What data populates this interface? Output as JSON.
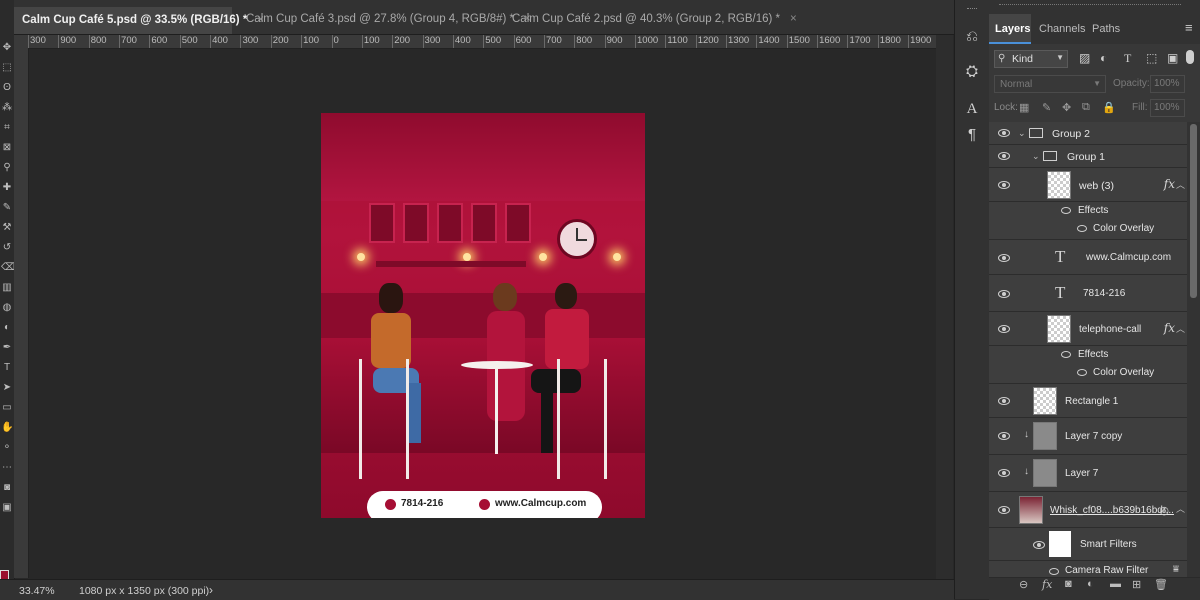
{
  "tabs": [
    {
      "label": "Calm Cup Café 5.psd @ 33.5% (RGB/16) *",
      "active": true
    },
    {
      "label": "Calm Cup Café 3.psd @ 27.8% (Group 4, RGB/8#) *",
      "active": false
    },
    {
      "label": "Calm Cup Café 2.psd @ 40.3% (Group 2, RGB/16) *",
      "active": false
    }
  ],
  "tab_close": "×",
  "ruler": [
    "300",
    "900",
    "800",
    "700",
    "600",
    "500",
    "400",
    "300",
    "200",
    "100",
    "0",
    "100",
    "200",
    "300",
    "400",
    "500",
    "600",
    "700",
    "800",
    "900",
    "1000",
    "1100",
    "1200",
    "1300",
    "1400",
    "1500",
    "1600",
    "1700",
    "1800",
    "1900",
    "200"
  ],
  "status": {
    "zoom": "33.47%",
    "doc_size": "1080 px x 1350 px (300 ppi)",
    "arrow": "›"
  },
  "artwork": {
    "phone": "7814-216",
    "web": "www.Calmcup.com"
  },
  "panel": {
    "tabs": [
      "Layers",
      "Channels",
      "Paths"
    ],
    "menu_icon": "≡",
    "filter_kind": "Kind",
    "blend_mode": "Normal",
    "opacity_label": "Opacity:",
    "opacity_value": "100%",
    "lock_label": "Lock:",
    "fill_label": "Fill:",
    "fill_value": "100%"
  },
  "layers": [
    {
      "name": "Group 2",
      "type": "group"
    },
    {
      "name": "Group 1",
      "type": "group"
    },
    {
      "name": "web (3)",
      "type": "smart",
      "fx": "fx"
    },
    {
      "name": "Effects",
      "type": "effects"
    },
    {
      "name": "Color Overlay",
      "type": "effect"
    },
    {
      "name": "www.Calmcup.com",
      "type": "text"
    },
    {
      "name": "7814-216",
      "type": "text"
    },
    {
      "name": "telephone-call",
      "type": "smart",
      "fx": "fx"
    },
    {
      "name": "Effects",
      "type": "effects"
    },
    {
      "name": "Color Overlay",
      "type": "effect"
    },
    {
      "name": "Rectangle 1",
      "type": "shape"
    },
    {
      "name": "Layer 7 copy",
      "type": "pixel"
    },
    {
      "name": "Layer 7",
      "type": "pixel"
    },
    {
      "name": "Whisk_cf08....b639b16bdr...",
      "type": "smart"
    },
    {
      "name": "Smart Filters",
      "type": "smartfilters"
    },
    {
      "name": "Camera Raw Filter",
      "type": "filter"
    }
  ],
  "colors": {
    "artboard": "#a60e34",
    "foreground_swatch": "#9b0f2e",
    "active_tab": "#454545"
  }
}
